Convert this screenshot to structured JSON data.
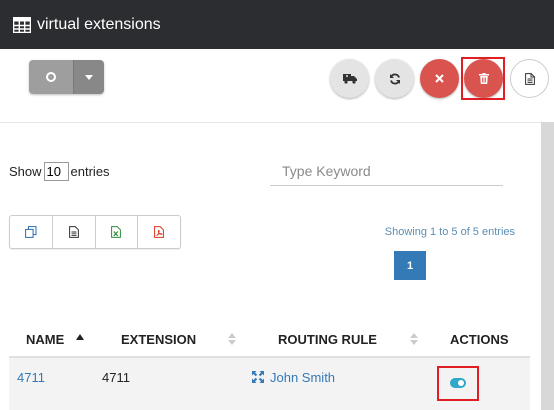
{
  "header": {
    "title": "virtual extensions",
    "icon": "table-grid-icon"
  },
  "toolbar": {
    "split_button_icon": "circle-icon",
    "buttons": [
      {
        "name": "ambulance-button",
        "icon": "ambulance-icon"
      },
      {
        "name": "refresh-button",
        "icon": "refresh-icon"
      },
      {
        "name": "close-button",
        "icon": "close-icon"
      },
      {
        "name": "delete-button",
        "icon": "trash-icon",
        "highlighted": true
      },
      {
        "name": "document-button",
        "icon": "document-icon"
      }
    ]
  },
  "length": {
    "show_label": "Show",
    "value": "10",
    "entries_label": "entries"
  },
  "search": {
    "placeholder": "Type Keyword"
  },
  "export": {
    "icons": [
      "copy-icon",
      "document-icon",
      "excel-icon",
      "pdf-icon"
    ]
  },
  "pagination": {
    "info": "Showing 1 to 5 of 5 entries",
    "current_page": "1"
  },
  "table": {
    "columns": [
      {
        "label": "NAME",
        "sort": "asc"
      },
      {
        "label": "EXTENSION",
        "sort": "both"
      },
      {
        "label": "ROUTING RULE",
        "sort": "both"
      },
      {
        "label": "ACTIONS",
        "sort": "none"
      }
    ],
    "rows": [
      {
        "name": "4711",
        "extension": "4711",
        "routing_rule": "John Smith",
        "routing_icon": "expand-arrows-icon",
        "action_icon": "toggle-icon"
      }
    ]
  },
  "colors": {
    "header_bg": "#2b2d31",
    "accent": "#337ab7",
    "danger": "#d9534f",
    "highlight": "#e21e25"
  }
}
